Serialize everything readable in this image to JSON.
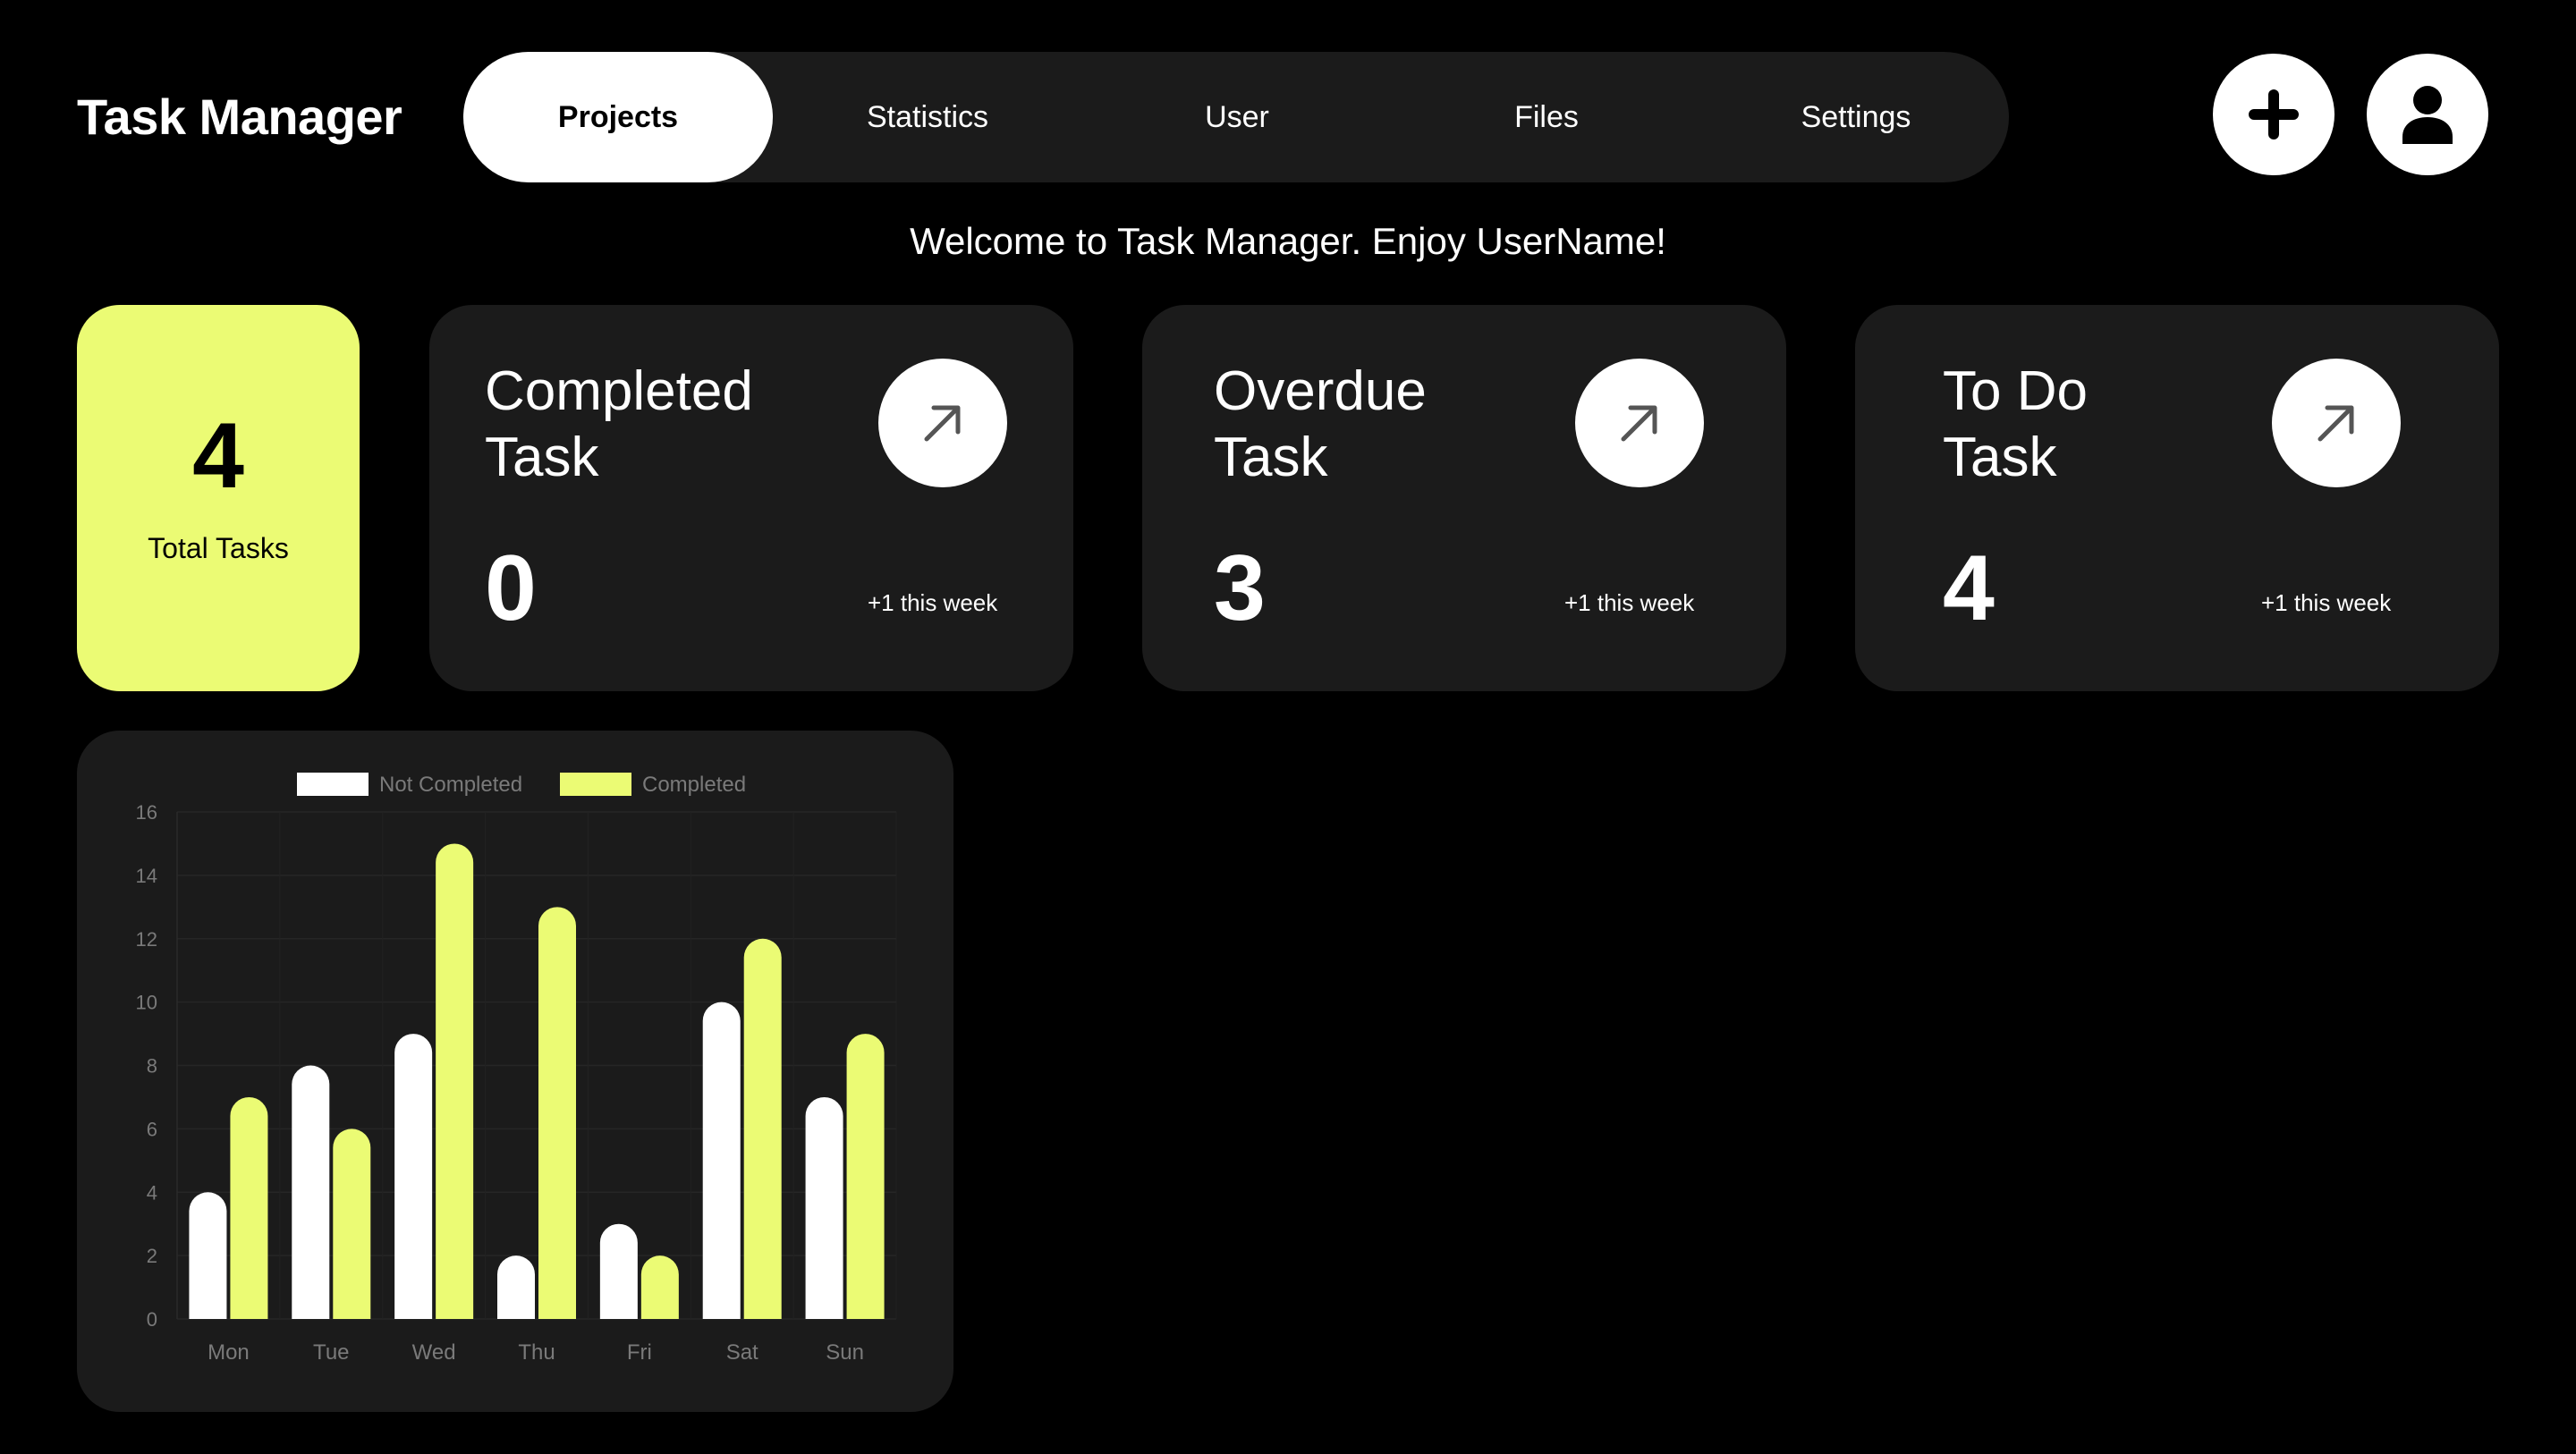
{
  "header": {
    "title": "Task Manager",
    "tabs": [
      {
        "label": "Projects",
        "active": true
      },
      {
        "label": "Statistics",
        "active": false
      },
      {
        "label": "User",
        "active": false
      },
      {
        "label": "Files",
        "active": false
      },
      {
        "label": "Settings",
        "active": false
      }
    ],
    "add_icon": "plus-icon",
    "profile_icon": "user-icon"
  },
  "welcome": "Welcome to Task Manager. Enjoy UserName!",
  "summary": {
    "total": {
      "value": "4",
      "label": "Total Tasks"
    },
    "cards": [
      {
        "title_line1": "Completed",
        "title_line2": "Task",
        "value": "0",
        "week": "+1 this week",
        "icon": "arrow-up-right-icon"
      },
      {
        "title_line1": "Overdue",
        "title_line2": "Task",
        "value": "3",
        "week": "+1 this week",
        "icon": "arrow-up-right-icon"
      },
      {
        "title_line1": "To Do",
        "title_line2": "Task",
        "value": "4",
        "week": "+1 this week",
        "icon": "arrow-up-right-icon"
      }
    ]
  },
  "colors": {
    "accent": "#ebfb74",
    "card_bg": "#1b1b1b",
    "background": "#000000",
    "not_completed": "#ffffff",
    "completed": "#ebfb74"
  },
  "chart_data": {
    "type": "bar",
    "categories": [
      "Mon",
      "Tue",
      "Wed",
      "Thu",
      "Fri",
      "Sat",
      "Sun"
    ],
    "series": [
      {
        "name": "Not Completed",
        "color": "#ffffff",
        "values": [
          4,
          8,
          9,
          2,
          3,
          10,
          7
        ]
      },
      {
        "name": "Completed",
        "color": "#ebfb74",
        "values": [
          7,
          6,
          15,
          13,
          2,
          12,
          9
        ]
      }
    ],
    "ylim": [
      0,
      16
    ],
    "yticks": [
      0,
      2,
      4,
      6,
      8,
      10,
      12,
      14,
      16
    ],
    "legend": "top-center",
    "grid": true
  }
}
